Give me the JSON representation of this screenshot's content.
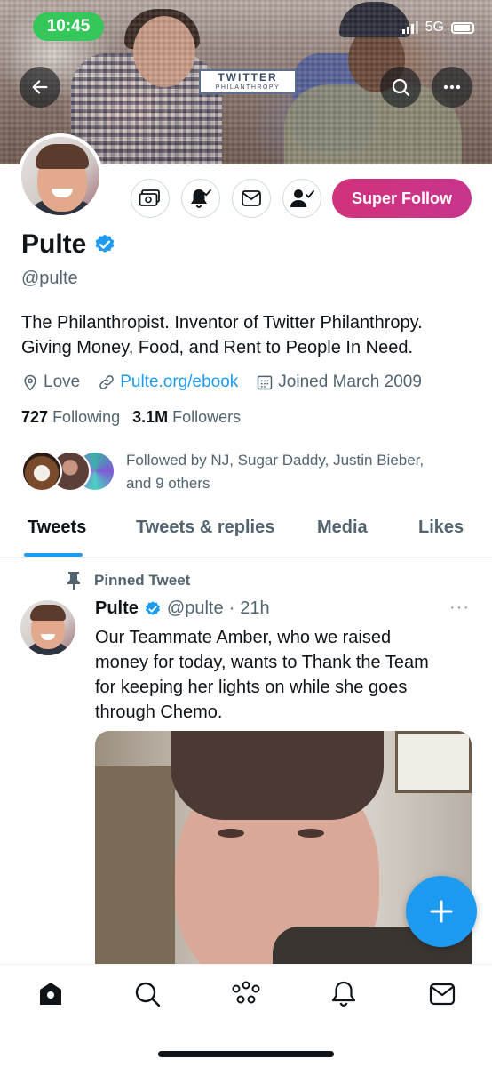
{
  "status_bar": {
    "time": "10:45",
    "network": "5G"
  },
  "banner": {
    "logo_line1": "TWITTER",
    "logo_line2": "PHILANTHROPY",
    "back_icon": "arrow-left-icon",
    "search_icon": "search-icon",
    "more_icon": "more-horizontal-icon"
  },
  "actions": {
    "tip_icon": "money-icon",
    "notify_icon": "bell-check-icon",
    "message_icon": "envelope-icon",
    "following_icon": "person-check-icon",
    "super_follow_label": "Super Follow"
  },
  "profile": {
    "name": "Pulte",
    "handle": "@pulte",
    "bio_line1": "The Philanthropist. Inventor of Twitter Philanthropy.",
    "bio_line2": "Giving Money, Food, and Rent to People In Need.",
    "location": "Love",
    "website": "Pulte.org/ebook",
    "joined": "Joined March 2009",
    "following_count": "727",
    "following_label": "Following",
    "followers_count": "3.1M",
    "followers_label": "Followers",
    "followed_by_line1": "Followed by NJ, Sugar Daddy, Justin Bieber,",
    "followed_by_line2": "and 9 others"
  },
  "tabs": [
    {
      "label": "Tweets",
      "active": true
    },
    {
      "label": "Tweets & replies",
      "active": false
    },
    {
      "label": "Media",
      "active": false
    },
    {
      "label": "Likes",
      "active": false
    }
  ],
  "pinned_tweet": {
    "pinned_label": "Pinned Tweet",
    "author": "Pulte",
    "handle": "@pulte",
    "separator": "·",
    "time": "21h",
    "more": "···",
    "text_line1": "Our Teammate Amber, who we raised",
    "text_line2": "money for today, wants to Thank the Team",
    "text_line3": "for keeping her lights on while she goes",
    "text_line4": "through Chemo."
  },
  "bottom_nav": [
    "home-icon",
    "search-icon",
    "spaces-icon",
    "notifications-icon",
    "messages-icon"
  ],
  "colors": {
    "accent": "#1d9bf0",
    "super_follow": "#c9347f",
    "status_green": "#35c759",
    "text_primary": "#0f1419",
    "text_secondary": "#536471"
  }
}
